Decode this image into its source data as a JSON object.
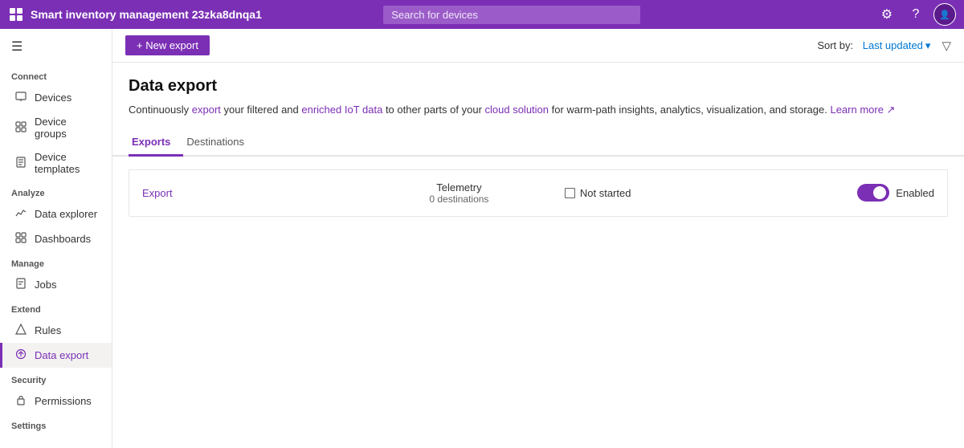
{
  "app": {
    "title": "Smart inventory management 23zka8dnqa1",
    "logo_unicode": "◈"
  },
  "search": {
    "placeholder": "Search for devices"
  },
  "topnav": {
    "settings_icon": "⚙",
    "help_icon": "?",
    "avatar_label": "👤"
  },
  "sidebar": {
    "hamburger": "☰",
    "sections": [
      {
        "label": "Connect",
        "items": [
          {
            "id": "devices",
            "label": "Devices",
            "icon": "⊡"
          },
          {
            "id": "device-groups",
            "label": "Device groups",
            "icon": "⊞"
          },
          {
            "id": "device-templates",
            "label": "Device templates",
            "icon": "⊟"
          }
        ]
      },
      {
        "label": "Analyze",
        "items": [
          {
            "id": "data-explorer",
            "label": "Data explorer",
            "icon": "📈"
          },
          {
            "id": "dashboards",
            "label": "Dashboards",
            "icon": "⊞"
          }
        ]
      },
      {
        "label": "Manage",
        "items": [
          {
            "id": "jobs",
            "label": "Jobs",
            "icon": "⊡"
          }
        ]
      },
      {
        "label": "Extend",
        "items": [
          {
            "id": "rules",
            "label": "Rules",
            "icon": "⌬"
          },
          {
            "id": "data-export",
            "label": "Data export",
            "icon": "↗"
          }
        ]
      },
      {
        "label": "Security",
        "items": [
          {
            "id": "permissions",
            "label": "Permissions",
            "icon": "🔑"
          }
        ]
      },
      {
        "label": "Settings",
        "items": []
      }
    ]
  },
  "toolbar": {
    "new_export_label": "+ New export",
    "sort_by_label": "Sort by:",
    "sort_value": "Last updated",
    "filter_icon": "▽"
  },
  "page": {
    "title": "Data export",
    "description_plain": "Continuously ",
    "description_export_link": "export",
    "description_mid": " your filtered and enriched IoT data to other parts of your cloud solution for warm-path insights, analytics, visualization, and storage.",
    "description_learn": "Learn more",
    "description_full": "Continuously export your filtered and enriched IoT data to other parts of your cloud solution for warm-path insights, analytics, visualization, and storage. Learn more"
  },
  "tabs": [
    {
      "id": "exports",
      "label": "Exports",
      "active": true
    },
    {
      "id": "destinations",
      "label": "Destinations",
      "active": false
    }
  ],
  "export_row": {
    "name": "Export",
    "telemetry_label": "Telemetry",
    "destinations_label": "0 destinations",
    "status_label": "Not started",
    "toggle_label": "Enabled",
    "toggle_checked": true
  }
}
